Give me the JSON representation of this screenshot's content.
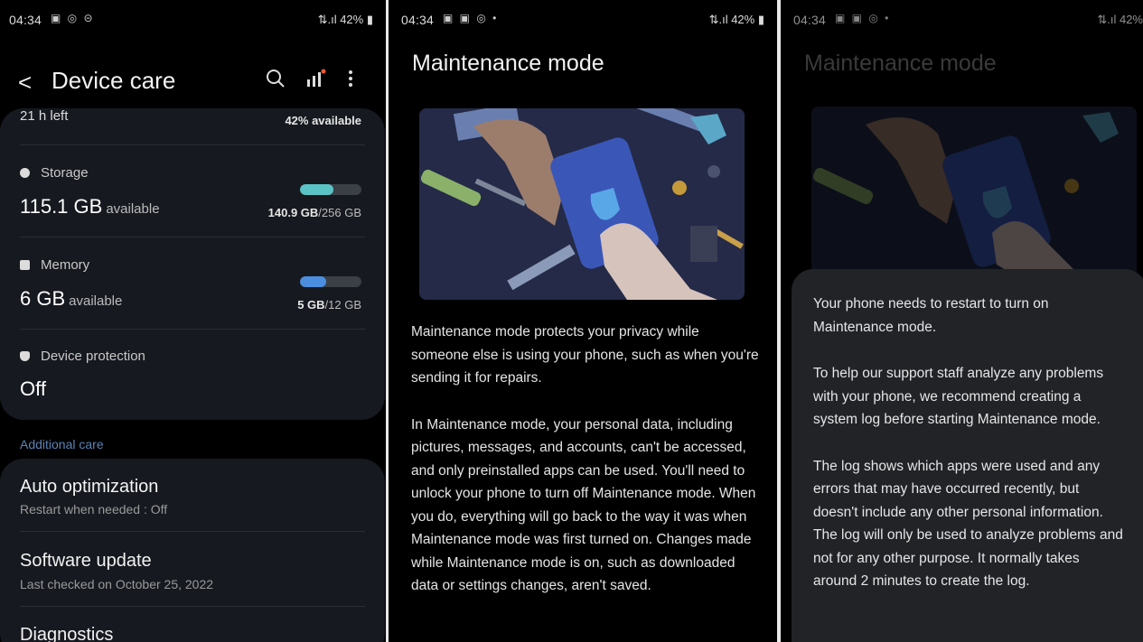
{
  "panel1": {
    "status": {
      "time": "04:34",
      "icons": "▣ ◎ ⊝",
      "right": "42%"
    },
    "appbar": {
      "title": "Device care",
      "back": "<"
    },
    "battery": {
      "left_text": "21 h left",
      "available": "42% available"
    },
    "storage": {
      "label": "Storage",
      "value": "115.1 GB",
      "unit": "available",
      "used": "140.9 GB",
      "total": "/256 GB",
      "fill_fraction": 0.55,
      "fill_color": "#5bc3c6"
    },
    "memory": {
      "label": "Memory",
      "value": "6 GB",
      "unit": "available",
      "used": "5 GB",
      "total": "/12 GB",
      "fill_fraction": 0.42,
      "fill_color": "#4b8ee0"
    },
    "protection": {
      "label": "Device protection",
      "value": "Off"
    },
    "additional_header": "Additional care",
    "items": [
      {
        "title": "Auto optimization",
        "sub": "Restart when needed : Off"
      },
      {
        "title": "Software update",
        "sub": "Last checked on October 25, 2022"
      },
      {
        "title": "Diagnostics",
        "sub": ""
      }
    ]
  },
  "panel2": {
    "status": {
      "time": "04:34",
      "icons": "▣ ▣ ◎ •",
      "right": "42%"
    },
    "title": "Maintenance mode",
    "paragraphs": [
      "Maintenance mode protects your privacy while someone else is using your phone, such as when you're sending it for repairs.",
      "In Maintenance mode, your personal data, including pictures, messages, and accounts, can't be accessed, and only preinstalled apps can be used. You'll need to unlock your phone to turn off Maintenance mode. When you do, everything will go back to the way it was when Maintenance mode was first turned on. Changes made while Maintenance mode is on, such as downloaded data or settings changes, aren't saved."
    ]
  },
  "panel3": {
    "status": {
      "time": "04:34",
      "icons": "▣ ▣ ◎ •",
      "right": "42%"
    },
    "title": "Maintenance mode",
    "paragraphs": [
      "Your phone needs to restart to turn on Maintenance mode.",
      "To help our support staff analyze any problems with your phone, we recommend creating a system log before starting Maintenance mode.",
      "The log shows which apps were used and any errors that may have occurred recently, but doesn't include any other personal information. The log will only be used to analyze problems and not for any other purpose. It normally takes around 2 minutes to create the log."
    ]
  }
}
